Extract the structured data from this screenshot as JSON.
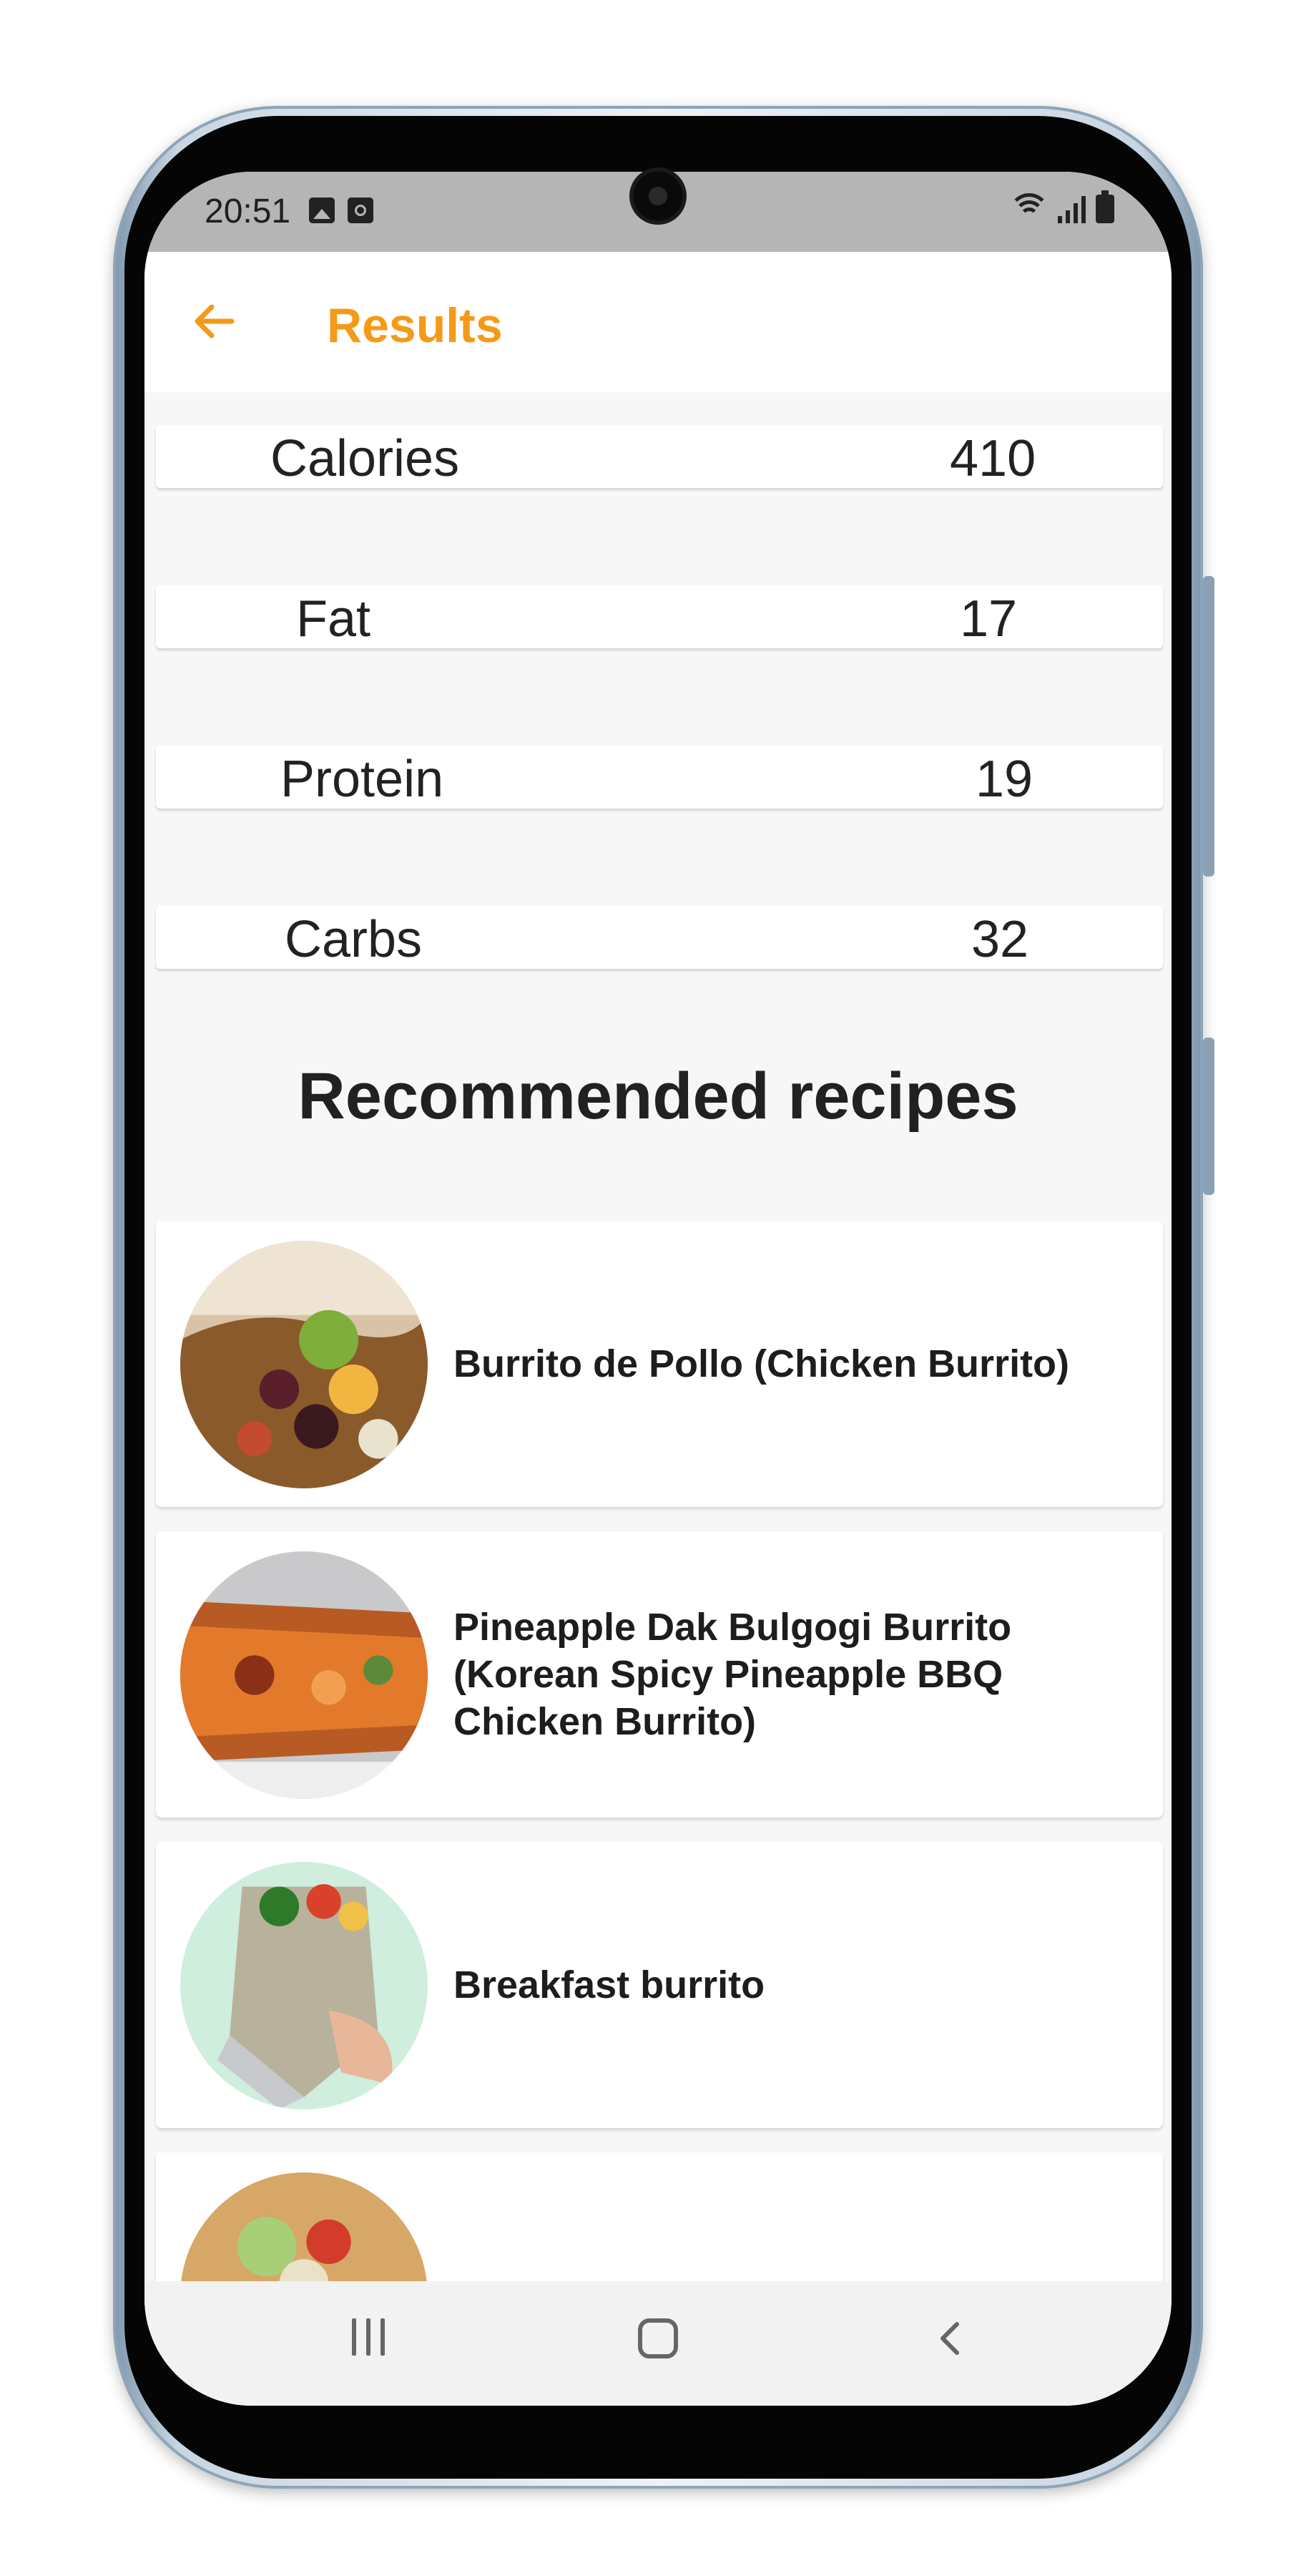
{
  "status_bar": {
    "time": "20:51",
    "left_icons": [
      "image-icon",
      "clock-app-icon"
    ],
    "right_icons": [
      "wifi-icon",
      "signal-icon",
      "battery-icon"
    ]
  },
  "app_bar": {
    "title": "Results",
    "back_icon": "arrow-left-icon",
    "accent_color": "#f59a18"
  },
  "nutrition": [
    {
      "label": "Calories",
      "value": "410"
    },
    {
      "label": "Fat",
      "value": "17"
    },
    {
      "label": "Protein",
      "value": "19"
    },
    {
      "label": "Carbs",
      "value": "32"
    }
  ],
  "recipes_section": {
    "heading": "Recommended recipes",
    "items": [
      {
        "title": "Burrito de Pollo (Chicken Burrito)"
      },
      {
        "title": "Pineapple Dak Bulgogi Burrito (Korean Spicy Pineapple BBQ Chicken Burrito)"
      },
      {
        "title": "Breakfast burrito"
      },
      {
        "title": ""
      }
    ]
  },
  "nav_bar": {
    "icons": [
      "recent-apps-icon",
      "home-icon",
      "back-icon"
    ]
  }
}
